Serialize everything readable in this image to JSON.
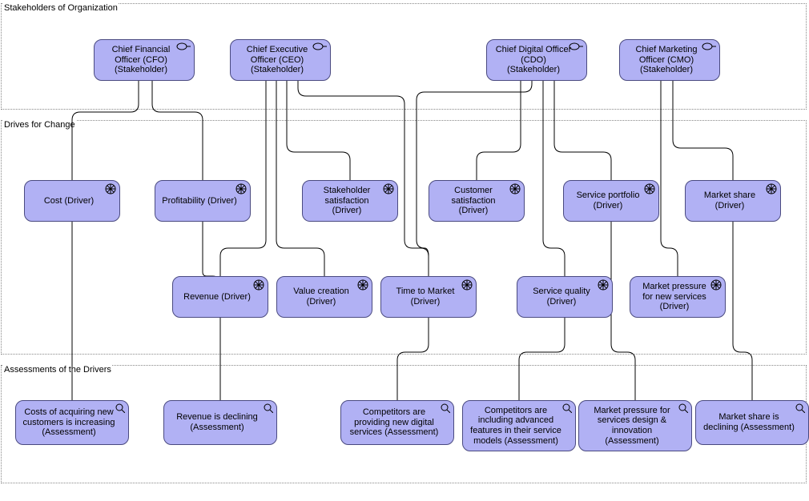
{
  "groups": {
    "g1": {
      "label": "Stakeholders of Organization"
    },
    "g2": {
      "label": "Drives for Change"
    },
    "g3": {
      "label": "Assessments of the Drivers"
    }
  },
  "nodes": {
    "cfo": "Chief Financial Officer (CFO) (Stakeholder)",
    "ceo": "Chief Executive Officer (CEO) (Stakeholder)",
    "cdo": "Chief Digital Officer (CDO) (Stakeholder)",
    "cmo": "Chief Marketing Officer (CMO) (Stakeholder)",
    "cost": "Cost (Driver)",
    "profit": "Profitability (Driver)",
    "stake": "Stakeholder satisfaction (Driver)",
    "cust": "Customer satisfaction (Driver)",
    "portfolio": "Service portfolio (Driver)",
    "mshare": "Market share (Driver)",
    "revenue": "Revenue (Driver)",
    "value": "Value creation (Driver)",
    "ttm": "Time to Market (Driver)",
    "squal": "Service quality (Driver)",
    "mpress": "Market pressure for new services (Driver)",
    "a_cost": "Costs of acquiring new customers is increasing (Assessment)",
    "a_rev": "Revenue is declining (Assessment)",
    "a_comp1": "Competitors are providing new digital services (Assessment)",
    "a_comp2": "Competitors are including advanced features in their service models (Assessment)",
    "a_mpress": "Market pressure for services design & innovation (Assessment)",
    "a_mshare": "Market share is declining (Assessment)"
  }
}
